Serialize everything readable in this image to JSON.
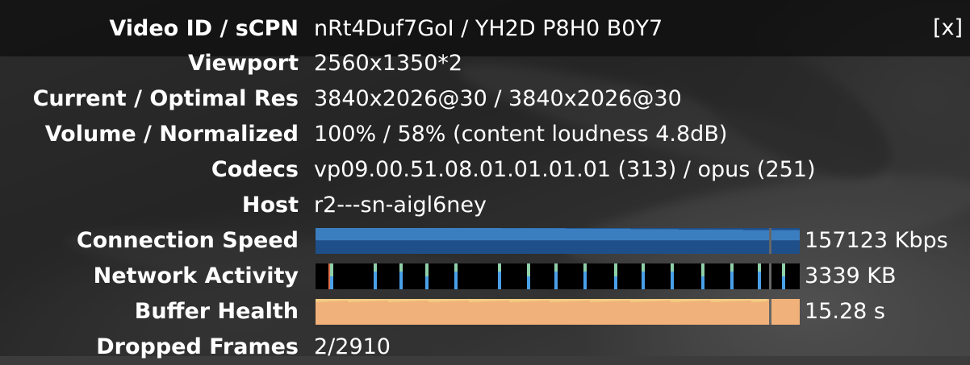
{
  "close_label": "[x]",
  "stats": {
    "video_id": {
      "label": "Video ID / sCPN",
      "value": "nRt4Duf7GoI / YH2D P8H0 B0Y7"
    },
    "viewport": {
      "label": "Viewport",
      "value": "2560x1350*2"
    },
    "resolution": {
      "label": "Current / Optimal Res",
      "value": "3840x2026@30 / 3840x2026@30"
    },
    "volume": {
      "label": "Volume / Normalized",
      "value": "100% / 58% (content loudness 4.8dB)"
    },
    "codecs": {
      "label": "Codecs",
      "value": "vp09.00.51.08.01.01.01.01 (313) / opus (251)"
    },
    "host": {
      "label": "Host",
      "value": "r2---sn-aigl6ney"
    },
    "connection_speed": {
      "label": "Connection Speed",
      "value": "157123 Kbps"
    },
    "network_activity": {
      "label": "Network Activity",
      "value": "3339 KB"
    },
    "buffer_health": {
      "label": "Buffer Health",
      "value": "15.28 s"
    },
    "dropped_frames": {
      "label": "Dropped Frames",
      "value": "2/2910"
    }
  },
  "colors": {
    "connection_light": "#3a7ec0",
    "connection_dark": "#1f4f88",
    "network_blue": "#4aa0e8",
    "network_green": "#8fd0a8",
    "buffer_orange": "#f0b27a",
    "buffer_yellow": "#f4e28a",
    "marker": "#666666"
  }
}
